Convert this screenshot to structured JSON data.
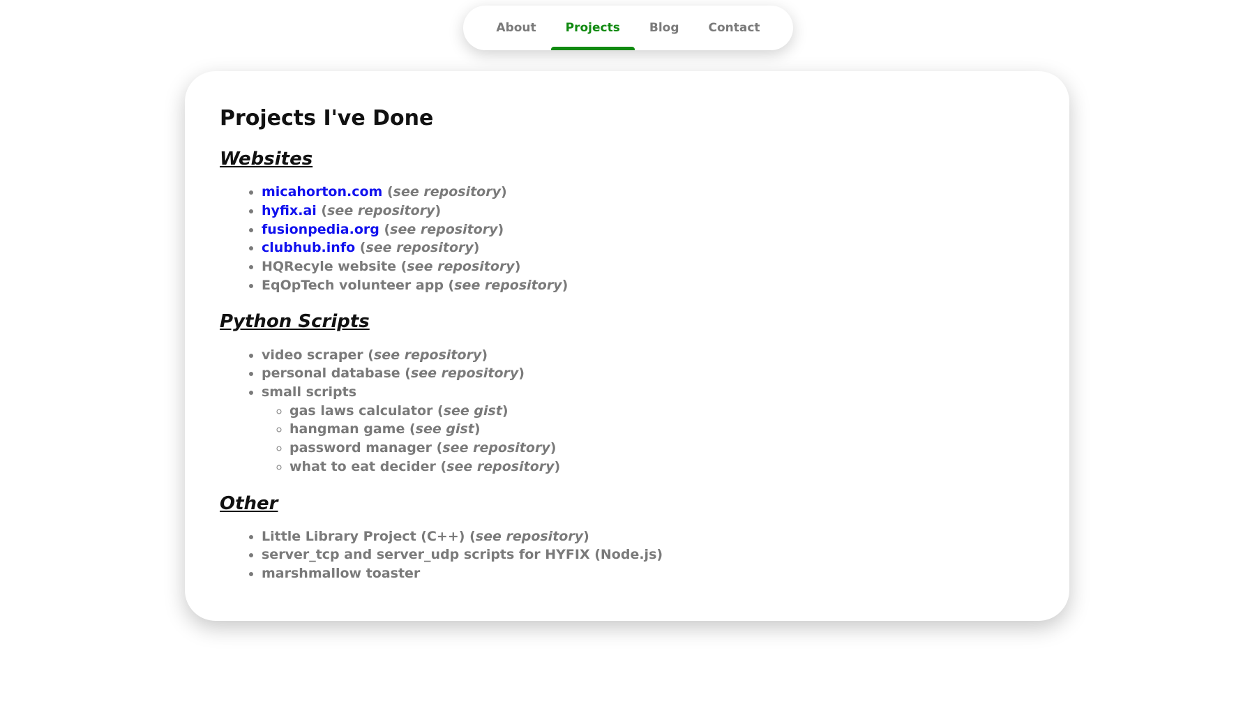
{
  "nav": {
    "items": [
      {
        "label": "About",
        "active": false
      },
      {
        "label": "Projects",
        "active": true
      },
      {
        "label": "Blog",
        "active": false
      },
      {
        "label": "Contact",
        "active": false
      }
    ],
    "active_color": "#118a11",
    "inactive_color": "#7a7a7a"
  },
  "main": {
    "title": "Projects I've Done",
    "sections": {
      "websites": {
        "heading": "Websites",
        "items": [
          {
            "link": "micahorton.com",
            "note": "see repository"
          },
          {
            "link": "hyfix.ai",
            "note": "see repository"
          },
          {
            "link": "fusionpedia.org",
            "note": "see repository"
          },
          {
            "link": "clubhub.info",
            "note": "see repository"
          },
          {
            "text": "HQRecyle website",
            "note": "see repository"
          },
          {
            "text": "EqOpTech volunteer app",
            "note": "see repository"
          }
        ]
      },
      "python": {
        "heading": "Python Scripts",
        "items": [
          {
            "text": "video scraper",
            "note": "see repository"
          },
          {
            "text": "personal database",
            "note": "see repository"
          },
          {
            "text": "small scripts"
          }
        ],
        "small_scripts": [
          {
            "text": "gas laws calculator",
            "note": "see gist"
          },
          {
            "text": "hangman game",
            "note": "see gist"
          },
          {
            "text": "password manager",
            "note": "see repository"
          },
          {
            "text": "what to eat decider",
            "note": "see repository"
          }
        ]
      },
      "other": {
        "heading": "Other",
        "items": [
          {
            "text": "Little Library Project (C++)",
            "note": "see repository"
          },
          {
            "text": "server_tcp and server_udp scripts for HYFIX (Node.js)"
          },
          {
            "text": "marshmallow toaster"
          }
        ]
      }
    }
  },
  "colors": {
    "link": "#1111ee",
    "text_muted": "#7a7a7a",
    "heading": "#111111"
  }
}
